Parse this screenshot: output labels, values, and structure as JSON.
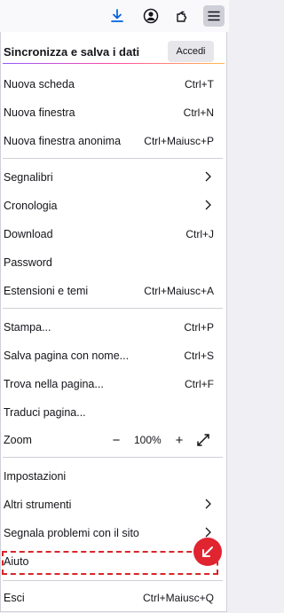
{
  "toolbar": {
    "buttons": [
      {
        "name": "download-icon",
        "color": "#0061e0"
      },
      {
        "name": "account-icon"
      },
      {
        "name": "extensions-icon"
      },
      {
        "name": "menu-icon",
        "active": true
      }
    ]
  },
  "sync": {
    "title": "Sincronizza e salva i dati",
    "signin_label": "Accedi"
  },
  "menu": {
    "new_tab": {
      "label": "Nuova scheda",
      "shortcut": "Ctrl+T"
    },
    "new_window": {
      "label": "Nuova finestra",
      "shortcut": "Ctrl+N"
    },
    "new_private": {
      "label": "Nuova finestra anonima",
      "shortcut": "Ctrl+Maiusc+P"
    },
    "bookmarks": {
      "label": "Segnalibri"
    },
    "history": {
      "label": "Cronologia"
    },
    "downloads": {
      "label": "Download",
      "shortcut": "Ctrl+J"
    },
    "passwords": {
      "label": "Password"
    },
    "addons": {
      "label": "Estensioni e temi",
      "shortcut": "Ctrl+Maiusc+A"
    },
    "print": {
      "label": "Stampa...",
      "shortcut": "Ctrl+P"
    },
    "save_page": {
      "label": "Salva pagina con nome...",
      "shortcut": "Ctrl+S"
    },
    "find": {
      "label": "Trova nella pagina...",
      "shortcut": "Ctrl+F"
    },
    "translate": {
      "label": "Traduci pagina..."
    },
    "zoom": {
      "label": "Zoom",
      "minus": "−",
      "value": "100%",
      "plus": "+"
    },
    "settings": {
      "label": "Impostazioni"
    },
    "more_tools": {
      "label": "Altri strumenti"
    },
    "report": {
      "label": "Segnala problemi con il sito"
    },
    "help": {
      "label": "Aiuto"
    },
    "exit": {
      "label": "Esci",
      "shortcut": "Ctrl+Maiusc+Q"
    }
  },
  "colors": {
    "highlight": "#d7262b",
    "badge": "#e02430"
  }
}
